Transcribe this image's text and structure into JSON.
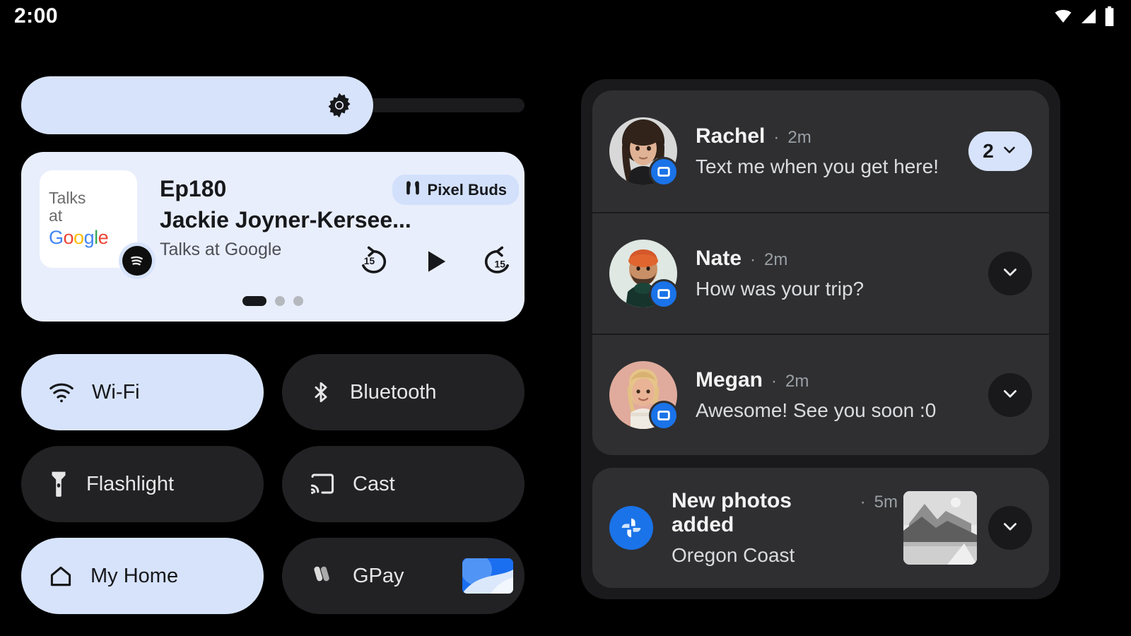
{
  "status_bar": {
    "clock": "2:00",
    "icons": [
      "wifi-icon",
      "cellular-signal-icon",
      "battery-icon"
    ]
  },
  "quick_settings": {
    "brightness": {
      "name": "brightness-slider",
      "icon": "brightness-icon",
      "fill_percent": 70
    },
    "media_player": {
      "episode": "Ep180",
      "title": "Jackie Joyner-Kersee...",
      "app_name": "Talks at Google",
      "album_art_line1": "Talks",
      "album_art_line2": "at",
      "album_art_brand": "Google",
      "app_badge_icon": "spotify-icon",
      "output_device": {
        "label": "Pixel Buds",
        "icon": "earbuds-icon"
      },
      "controls": [
        {
          "name": "rewind-15-button",
          "label": "15"
        },
        {
          "name": "play-button",
          "label": ""
        },
        {
          "name": "forward-15-button",
          "label": "15"
        }
      ],
      "pages": {
        "total": 3,
        "active": 1
      }
    },
    "tiles": [
      {
        "label": "Wi-Fi",
        "icon": "wifi-icon",
        "active": true,
        "name": "tile-wifi"
      },
      {
        "label": "Bluetooth",
        "icon": "bluetooth-icon",
        "active": false,
        "name": "tile-bluetooth"
      },
      {
        "label": "Flashlight",
        "icon": "flashlight-icon",
        "active": false,
        "name": "tile-flashlight"
      },
      {
        "label": "Cast",
        "icon": "cast-icon",
        "active": false,
        "name": "tile-cast"
      },
      {
        "label": "My Home",
        "icon": "home-icon",
        "active": true,
        "name": "tile-my-home"
      },
      {
        "label": "GPay",
        "icon": "gpay-icon",
        "active": false,
        "name": "tile-gpay",
        "thumbnail": "payment-card-thumbnail"
      }
    ]
  },
  "notifications": {
    "messages": [
      {
        "name": "Rachel",
        "separator": "·",
        "time": "2m",
        "message": "Text me when you get here!",
        "app_badge_icon": "messages-icon",
        "count": "2",
        "action": "count-chevron-chip"
      },
      {
        "name": "Nate",
        "separator": "·",
        "time": "2m",
        "message": "How was your trip?",
        "app_badge_icon": "messages-icon",
        "action": "chevron-down-button"
      },
      {
        "name": "Megan",
        "separator": "·",
        "time": "2m",
        "message": "Awesome! See you soon :0",
        "app_badge_icon": "messages-icon",
        "action": "chevron-down-button"
      }
    ],
    "photos": {
      "title": "New photos added",
      "separator": "·",
      "time": "5m",
      "subtitle": "Oregon Coast",
      "app_icon": "google-photos-icon",
      "thumbnail": "landscape-photo-thumbnail",
      "action": "chevron-down-button"
    }
  },
  "colors": {
    "background": "#000000",
    "tile_active": "#d7e3fb",
    "tile_inactive": "#222224",
    "media_card": "#e9eefc",
    "notif_panel": "#1a1a1c",
    "notif_card": "#2f2f31",
    "accent_blue": "#1a73e8"
  }
}
